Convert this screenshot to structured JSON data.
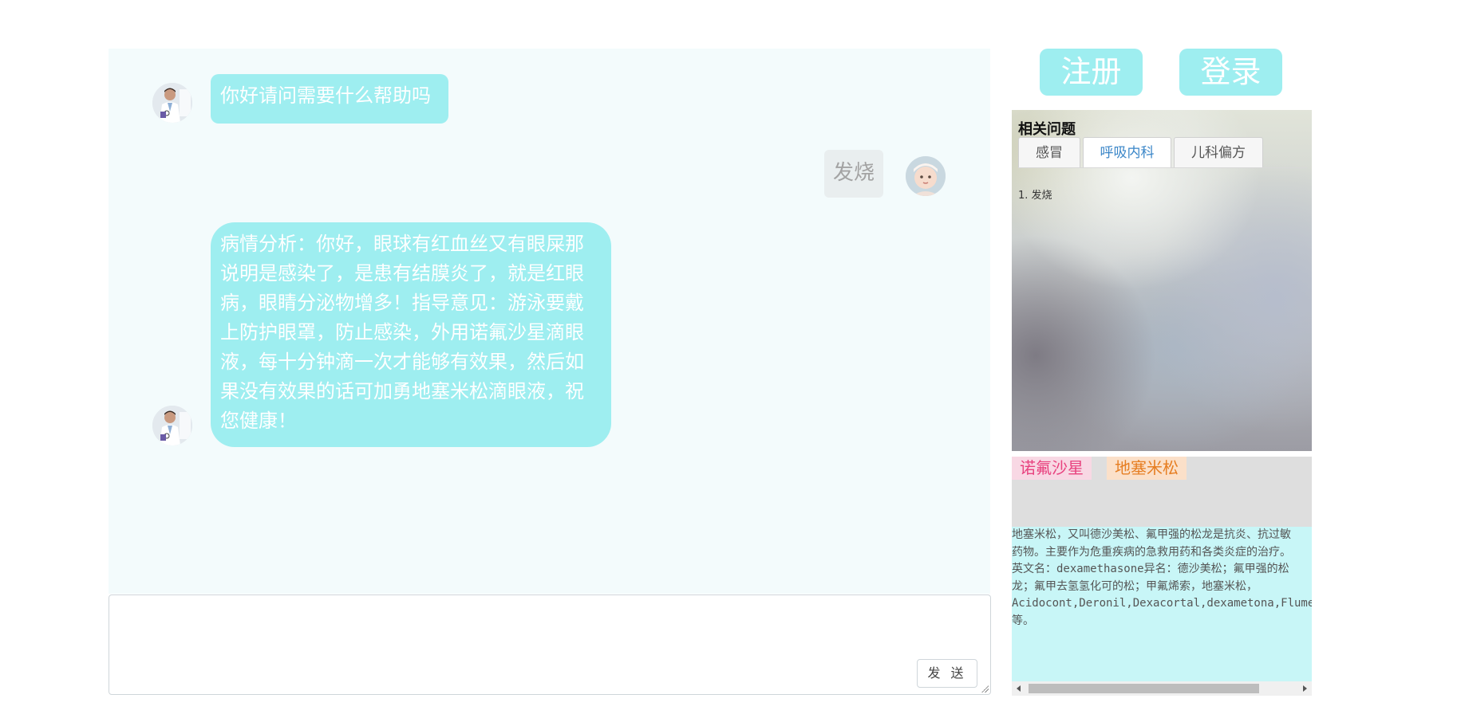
{
  "header": {
    "register_label": "注册",
    "login_label": "登录"
  },
  "chat": {
    "messages": [
      {
        "role": "bot",
        "text": "你好请问需要什么帮助吗"
      },
      {
        "role": "user",
        "text": "发烧"
      },
      {
        "role": "bot",
        "text": "病情分析：你好，眼球有红血丝又有眼屎那\n说明是感染了，是患有结膜炎了，就是红眼\n病，眼睛分泌物增多！指导意见：游泳要戴\n上防护眼罩，防止感染，外用诺氟沙星滴眼\n液，每十分钟滴一次才能够有效果，然后如\n果没有效果的话可加勇地塞米松滴眼液，祝\n您健康！"
      }
    ],
    "input_value": "",
    "send_label": "发 送"
  },
  "related": {
    "title": "相关问题",
    "tabs": [
      {
        "label": "感冒",
        "active": false
      },
      {
        "label": "呼吸内科",
        "active": true
      },
      {
        "label": "儿科偏方",
        "active": false
      }
    ],
    "questions": [
      "1. 发烧"
    ]
  },
  "medicine": {
    "tags": [
      {
        "label": "诺氟沙星",
        "color": "#e8427f",
        "bg": "#f8d8e4"
      },
      {
        "label": "地塞米松",
        "color": "#e67e22",
        "bg": "#fbe0c9"
      }
    ],
    "description": "地塞米松，又叫德沙美松、氟甲强的松龙是抗炎、抗过敏\n药物。主要作为危重疾病的急救用药和各类炎症的治疗。\n英文名：dexamethasone异名：德沙美松；氟甲强的松\n龙；氟甲去氢氢化可的松；甲氟烯索，地塞米松，\nAcidocont,Deronil,Dexacortal,dexametona,Flumepred\n等。"
  },
  "colors": {
    "accent": "#9eeef0",
    "chat_bg": "#f3fbfc",
    "med_bg": "#c8f6f7",
    "tab_active": "#3a86c8"
  },
  "icons": [
    "doctor-avatar-icon",
    "baby-avatar-icon"
  ]
}
